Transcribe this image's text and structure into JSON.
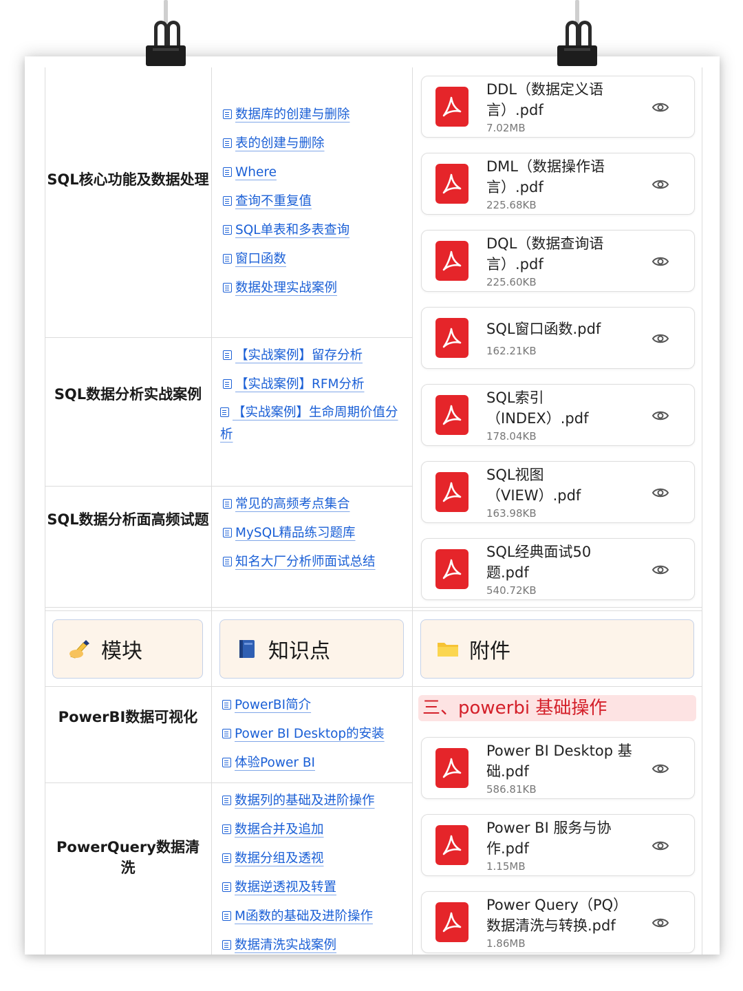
{
  "modules": [
    {
      "label": "SQL核心功能及数据处理",
      "links": [
        "数据库的创建与删除",
        "表的创建与删除",
        "Where",
        "查询不重复值",
        "SQL单表和多表查询",
        "窗口函数",
        "数据处理实战案例"
      ]
    },
    {
      "label": "SQL数据分析实战案例",
      "links": [
        "【实战案例】留存分析",
        "【实战案例】RFM分析",
        "【实战案例】生命周期价值分析"
      ]
    },
    {
      "label": "SQL数据分析面高频试题",
      "links": [
        "常见的高频考点集合",
        "MySQL精品练习题库",
        "知名大厂分析师面试总结"
      ]
    },
    {
      "label": "PowerBI数据可视化",
      "links": [
        "PowerBI简介",
        "Power BI Desktop的安装",
        "体验Power BI"
      ]
    },
    {
      "label": "PowerQuery数据清洗",
      "links": [
        "数据列的基础及进阶操作",
        "数据合并及追加",
        "数据分组及透视",
        "数据逆透视及转置",
        "M函数的基础及进阶操作",
        "数据清洗实战案例"
      ]
    }
  ],
  "attachments_top": [
    {
      "name": "DDL（数据定义语言）.pdf",
      "size": "7.02MB"
    },
    {
      "name": "DML（数据操作语言）.pdf",
      "size": "225.68KB"
    },
    {
      "name": "DQL（数据查询语言）.pdf",
      "size": "225.60KB"
    },
    {
      "name": "SQL窗口函数.pdf",
      "size": "162.21KB"
    },
    {
      "name": "SQL索引（INDEX）.pdf",
      "size": "178.04KB"
    },
    {
      "name": "SQL视图（VIEW）.pdf",
      "size": "163.98KB"
    },
    {
      "name": "SQL经典面试50题.pdf",
      "size": "540.72KB"
    }
  ],
  "header": {
    "module": "模块",
    "knowledge": "知识点",
    "attachment": "附件"
  },
  "section_title": "三、powerbi 基础操作",
  "attachments_bottom": [
    {
      "name": "Power BI Desktop 基础.pdf",
      "size": "586.81KB"
    },
    {
      "name": "Power BI 服务与协作.pdf",
      "size": "1.15MB"
    },
    {
      "name": "Power Query（PQ）数据清洗与转换.pdf",
      "size": "1.86MB"
    }
  ],
  "colors": {
    "link": "#1a5fd6",
    "pdf_red": "#e5252a",
    "section_red": "#d4202a",
    "header_bg": "#fdf4ea"
  },
  "icons": {
    "module": "writing-hand-icon",
    "knowledge": "blue-book-icon",
    "attachment": "folder-icon",
    "card": "pdf-icon",
    "preview": "eye-icon",
    "link": "doc-icon"
  }
}
